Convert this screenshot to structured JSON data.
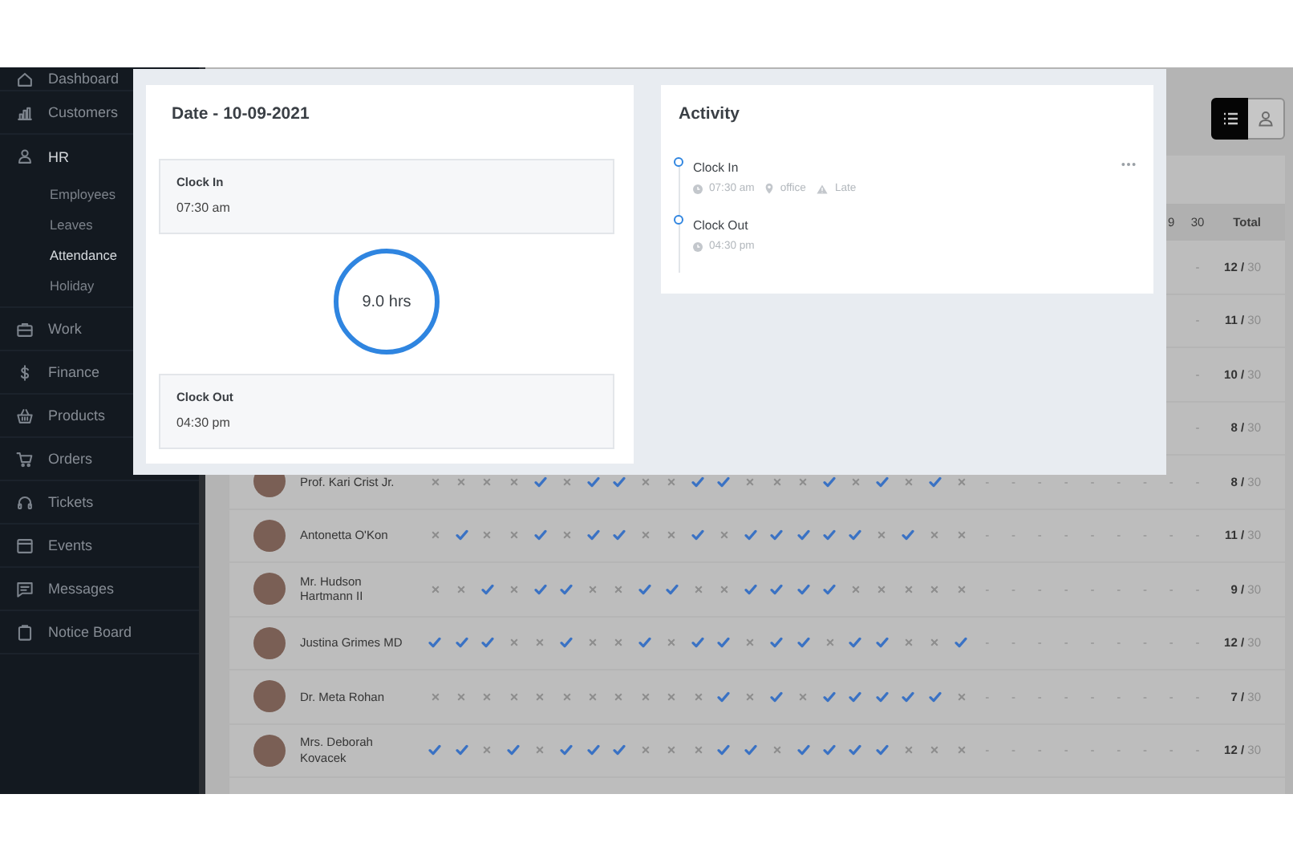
{
  "sidebar": {
    "items": [
      {
        "label": "Dashboard",
        "selected": false
      },
      {
        "label": "Customers",
        "selected": false
      },
      {
        "label": "HR",
        "selected": false,
        "children": [
          {
            "label": "Employees",
            "selected": false
          },
          {
            "label": "Leaves",
            "selected": false
          },
          {
            "label": "Attendance",
            "selected": true
          },
          {
            "label": "Holiday",
            "selected": false
          }
        ]
      },
      {
        "label": "Work",
        "selected": false
      },
      {
        "label": "Finance",
        "selected": false
      },
      {
        "label": "Products",
        "selected": false
      },
      {
        "label": "Orders",
        "selected": false
      },
      {
        "label": "Tickets",
        "selected": false
      },
      {
        "label": "Events",
        "selected": false
      },
      {
        "label": "Messages",
        "selected": false
      },
      {
        "label": "Notice Board",
        "selected": false
      }
    ]
  },
  "view_toggle": [
    {
      "kind": "list",
      "selected": true
    },
    {
      "kind": "user",
      "selected": false
    }
  ],
  "attendance": {
    "day_headers": [
      "9",
      "30"
    ],
    "total_header": "Total",
    "rows": [
      {
        "pending_days": [
          "-"
        ],
        "total": "**12 /** 30"
      },
      {
        "pending_days": [
          "-"
        ],
        "total": "**11 /** 30"
      },
      {
        "pending_days": [
          "-"
        ],
        "total": "**10 /** 30"
      },
      {
        "pending_days": [
          "-"
        ],
        "total": "**8 /** 30"
      },
      {
        "name": "Prof. Kari Crist Jr.",
        "present_days": [
          false,
          false,
          false,
          false,
          true,
          false,
          true,
          true,
          false,
          false,
          true,
          true,
          false,
          false,
          false,
          true,
          false,
          true,
          false,
          true,
          false
        ],
        "pending_days": [
          "-",
          "-",
          "-",
          "-",
          "-",
          "-",
          "-",
          "-",
          "-"
        ],
        "total": "**8 /** 30"
      },
      {
        "name": "Antonetta O'Kon",
        "present_days": [
          false,
          true,
          false,
          false,
          true,
          false,
          true,
          true,
          false,
          false,
          true,
          false,
          true,
          true,
          true,
          true,
          true,
          false,
          true,
          false,
          false
        ],
        "pending_days": [
          "-",
          "-",
          "-",
          "-",
          "-",
          "-",
          "-",
          "-",
          "-"
        ],
        "total": "**11 /** 30"
      },
      {
        "name": "Mr. Hudson Hartmann II",
        "present_days": [
          false,
          false,
          true,
          false,
          true,
          true,
          false,
          false,
          true,
          true,
          false,
          false,
          true,
          true,
          true,
          true,
          false,
          false,
          false,
          false,
          false
        ],
        "pending_days": [
          "-",
          "-",
          "-",
          "-",
          "-",
          "-",
          "-",
          "-",
          "-"
        ],
        "total": "**9 /** 30"
      },
      {
        "name": "Justina Grimes MD",
        "present_days": [
          true,
          true,
          true,
          false,
          false,
          true,
          false,
          false,
          true,
          false,
          true,
          true,
          false,
          true,
          true,
          false,
          true,
          true,
          false,
          false,
          true
        ],
        "pending_days": [
          "-",
          "-",
          "-",
          "-",
          "-",
          "-",
          "-",
          "-",
          "-"
        ],
        "total": "**12 /** 30"
      },
      {
        "name": "Dr. Meta Rohan",
        "present_days": [
          false,
          false,
          false,
          false,
          false,
          false,
          false,
          false,
          false,
          false,
          false,
          true,
          false,
          true,
          false,
          true,
          true,
          true,
          true,
          true,
          false
        ],
        "pending_days": [
          "-",
          "-",
          "-",
          "-",
          "-",
          "-",
          "-",
          "-",
          "-"
        ],
        "total": "**7 /** 30"
      },
      {
        "name": "Mrs. Deborah Kovacek",
        "present_days": [
          true,
          true,
          false,
          true,
          false,
          true,
          true,
          true,
          false,
          false,
          false,
          true,
          true,
          false,
          true,
          true,
          true,
          true,
          false,
          false,
          false
        ],
        "pending_days": [
          "-",
          "-",
          "-",
          "-",
          "-",
          "-",
          "-",
          "-",
          "-"
        ],
        "total": "**12 /** 30"
      }
    ]
  },
  "modal": {
    "date_card": {
      "title": "Date - 10-09-2021",
      "clock_in": {
        "label": "Clock In",
        "time": "07:30 am"
      },
      "duration": "9.0 hrs",
      "clock_out": {
        "label": "Clock Out",
        "time": "04:30 pm"
      }
    },
    "activity": {
      "title": "Activity",
      "events": [
        {
          "title": "Clock In",
          "time": "07:30 am",
          "location": "office",
          "status": "Late"
        },
        {
          "title": "Clock Out",
          "time": "04:30 pm"
        }
      ]
    }
  }
}
